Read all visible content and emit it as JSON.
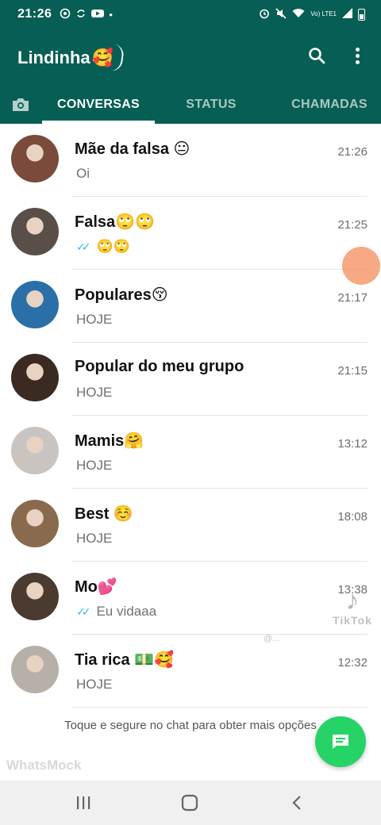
{
  "status_bar": {
    "time": "21:26",
    "left_icons": [
      "whatsapp-icon",
      "sync-icon",
      "youtube-icon",
      "dot-icon"
    ],
    "right_icons": [
      "alarm-icon",
      "mute-icon",
      "wifi-icon",
      "volte-icon",
      "signal-icon",
      "battery-icon"
    ],
    "network_label": "Vo) LTE1"
  },
  "app_bar": {
    "title": "Lindinha",
    "title_emoji": "🥰",
    "colors": {
      "primary": "#075e54",
      "accent": "#25d366",
      "read_tick": "#34b7f1"
    }
  },
  "tabs": [
    {
      "label": "CONVERSAS",
      "active": true
    },
    {
      "label": "STATUS",
      "active": false
    },
    {
      "label": "CHAMADAS",
      "active": false
    }
  ],
  "chats": [
    {
      "name": "Mãe da falsa 😐",
      "time": "21:26",
      "preview": "Oi",
      "read_ticks": false,
      "avatar_color": "#7a4a3a"
    },
    {
      "name": "Falsa🙄🙄",
      "time": "21:25",
      "preview": "🙄🙄",
      "read_ticks": true,
      "avatar_color": "#5a4f48"
    },
    {
      "name": "Populares😚",
      "time": "21:17",
      "preview": "HOJE",
      "read_ticks": false,
      "avatar_color": "#2a6fa8"
    },
    {
      "name": "Popular do meu grupo",
      "time": "21:15",
      "preview": "HOJE",
      "read_ticks": false,
      "avatar_color": "#3a2a22"
    },
    {
      "name": "Mamis🤗",
      "time": "13:12",
      "preview": "HOJE",
      "read_ticks": false,
      "avatar_color": "#c9c4bf"
    },
    {
      "name": "Best ☺️",
      "time": "18:08",
      "preview": "HOJE",
      "read_ticks": false,
      "avatar_color": "#8a6a4e"
    },
    {
      "name": "Mo💕",
      "time": "13:38",
      "preview": "Eu vidaaa",
      "read_ticks": true,
      "avatar_color": "#4a3a30"
    },
    {
      "name": "Tia rica 💵🥰",
      "time": "12:32",
      "preview": "HOJE",
      "read_ticks": false,
      "avatar_color": "#b7b0a8"
    }
  ],
  "hint": "Toque e segure no chat para obter mais opções",
  "watermark": "WhatsMock",
  "tiktok": {
    "logo": "♪",
    "label": "TikTok",
    "user": "@..."
  }
}
